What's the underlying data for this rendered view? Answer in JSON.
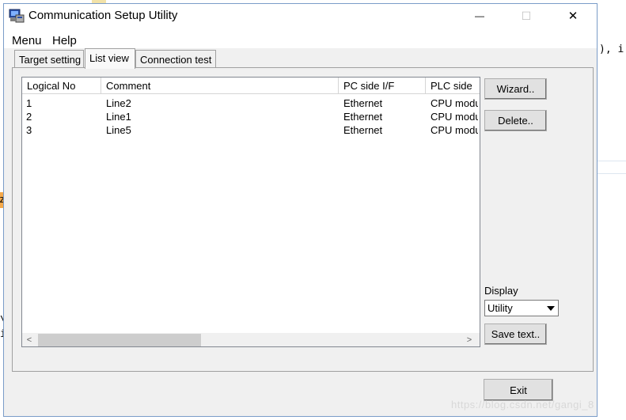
{
  "window": {
    "title": "Communication Setup Utility",
    "min_glyph": "—",
    "max_glyph": "☐",
    "close_glyph": "✕"
  },
  "menu": [
    "Menu",
    "Help"
  ],
  "tabs": [
    {
      "label": "Target setting",
      "active": false
    },
    {
      "label": "List view",
      "active": true
    },
    {
      "label": "Connection test",
      "active": false
    }
  ],
  "list": {
    "columns": [
      "Logical No",
      "Comment",
      "PC side I/F",
      "PLC side"
    ],
    "rows": [
      [
        "1",
        "Line2",
        "Ethernet",
        "CPU module"
      ],
      [
        "2",
        "Line1",
        "Ethernet",
        "CPU module"
      ],
      [
        "3",
        "Line5",
        "Ethernet",
        "CPU module"
      ]
    ]
  },
  "buttons": {
    "wizard": "Wizard..",
    "delete": "Delete..",
    "save_text": "Save text..",
    "exit": "Exit"
  },
  "display": {
    "label": "Display",
    "selected": "Utility"
  },
  "scroll": {
    "left": "<",
    "right": ">"
  },
  "background": {
    "code_fragment": "), i",
    "left_fragment_1": "\\",
    "left_fragment_2": "i",
    "orange_letter": "z",
    "watermark": "https://blog.csdn.net/gangi_8"
  }
}
